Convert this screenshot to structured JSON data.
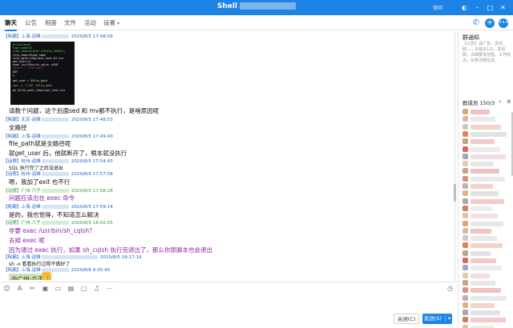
{
  "titlebar": {
    "title": "Shell",
    "user": "律明"
  },
  "tabs": [
    {
      "label": "聊天"
    },
    {
      "label": "公告"
    },
    {
      "label": "相册"
    },
    {
      "label": "文件"
    },
    {
      "label": "活动"
    },
    {
      "label": "设置"
    }
  ],
  "messages": [
    {
      "name": "【耗霸】上海-运维",
      "time": "2020/8/5 17:48:09"
    },
    {
      "text": "请教个问题，这个后面sed 和 mv都不执行，是啥原因呢"
    },
    {
      "name": "【耗霸】北京-运维",
      "time": "2020/8/5 17:48:53"
    },
    {
      "text": "全路径"
    },
    {
      "name": "【耗霸】上海-运维",
      "time": "2020/8/5 17:49:40"
    },
    {
      "text": "file_path就是全路径呢"
    },
    {
      "text": "就get_user 后，他就断开了，根本就没执行"
    },
    {
      "name": "【话痨】杭州-运维",
      "time": "2020/8/5 17:54:43"
    },
    {
      "text": "SQL 执行完了之后没退出"
    },
    {
      "name": "【话痨】杭州-运维",
      "time": "2020/8/5 17:57:08"
    },
    {
      "text": "嗯，我加了exit 也不行"
    },
    {
      "name": "【话痨】广州-六子",
      "time": "2020/8/5 17:58:28"
    },
    {
      "text": "问题应该出在 exec 命令"
    },
    {
      "name": "【耗霸】上海-运维",
      "time": "2020/8/5 17:59:14"
    },
    {
      "text": "是的，我也觉得，不知道怎么解决"
    },
    {
      "name": "【话痨】广州-六子",
      "time": "2020/8/5 18:02:55"
    },
    {
      "text": "非要 exec /usr/bin/sh_cqlsh？"
    },
    {
      "text": "去掉 exec 呢"
    },
    {
      "text": "因为通过 exec 执行，如果 sh_cqlsh 执行完退出了，那么你原脚本也会退出"
    },
    {
      "name": "【耗霸】上海-运维",
      "time": "2020/8/5 18:17:16"
    },
    {
      "text": "sh -x 看看执行过程不做好了"
    },
    {
      "name": "【耗霸】上海-运维",
      "time": "2020/8/6 9:35:40"
    },
    {
      "text": "@广州-六子"
    }
  ],
  "code_lines": [
    "#!/bin/bash",
    "type_name=$1",
    "time_name=$(date +%Y%m%d_%H%M%S)",
    "file_name=$type_name",
    "file_path=/tmp/user_text_01.txt",
    "get_user(){",
    "exec /usr/bin/sh_cqlsh <<EOF",
    "select * from user;",
    "EOF",
    "}",
    "get_user > $file_path",
    "sed -i '1,3d' $file_path",
    "mv $file_path /tmp/user_text.csv"
  ],
  "right_panel": {
    "notice_title": "群通知",
    "notice_text": "【公告】请广告、发招聘……天最多1次，发招聘，详细要求范围，工作地点，如果详细信息。",
    "members_label": "群成员",
    "members_count": "150/3"
  },
  "buttons": {
    "close": "关闭(C)",
    "send": "发送(S)"
  },
  "colors": {
    "accent": "#1d84e6",
    "name_blue": "#1d62c8",
    "name_green": "#2a9b3c",
    "purple_text": "#8b1ea8",
    "mention_bg": "#cfe5b4"
  },
  "icons": [
    "phone-icon",
    "add-icon",
    "more-icon",
    "emoji-icon",
    "font-icon",
    "scissors-icon",
    "image-icon",
    "folder-icon",
    "gift-icon",
    "bell-icon",
    "history-icon"
  ]
}
